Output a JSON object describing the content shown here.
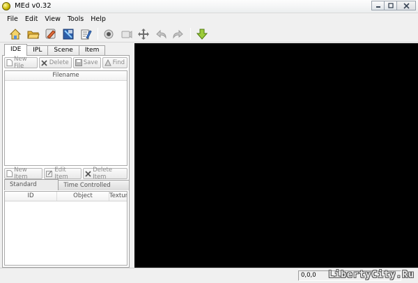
{
  "window": {
    "title": "MEd v0.32"
  },
  "menu": [
    "File",
    "Edit",
    "View",
    "Tools",
    "Help"
  ],
  "toolbar": {
    "icons": [
      "new-map-icon",
      "open-folder-icon",
      "edit-object-icon",
      "texture-icon",
      "properties-icon",
      "record-icon",
      "camera-icon",
      "move-icon",
      "undo-icon",
      "redo-icon",
      "download-icon"
    ]
  },
  "tabs": [
    "IDE",
    "IPL",
    "Scene",
    "Item"
  ],
  "ide_toolbar": {
    "new_file": "New File",
    "delete": "Delete",
    "save": "Save",
    "find": "Find"
  },
  "file_list": {
    "header": "Filename"
  },
  "item_toolbar": {
    "new_item": "New Item",
    "edit_item": "Edit Item",
    "delete_item": "Delete Item"
  },
  "object_tabs": [
    "Standard Objects",
    "Time Controlled Objects"
  ],
  "object_table": {
    "columns": [
      "ID",
      "Object",
      "Textur"
    ]
  },
  "status": {
    "coords": "0,0,0"
  },
  "watermark": "LibertyCity.Ru"
}
